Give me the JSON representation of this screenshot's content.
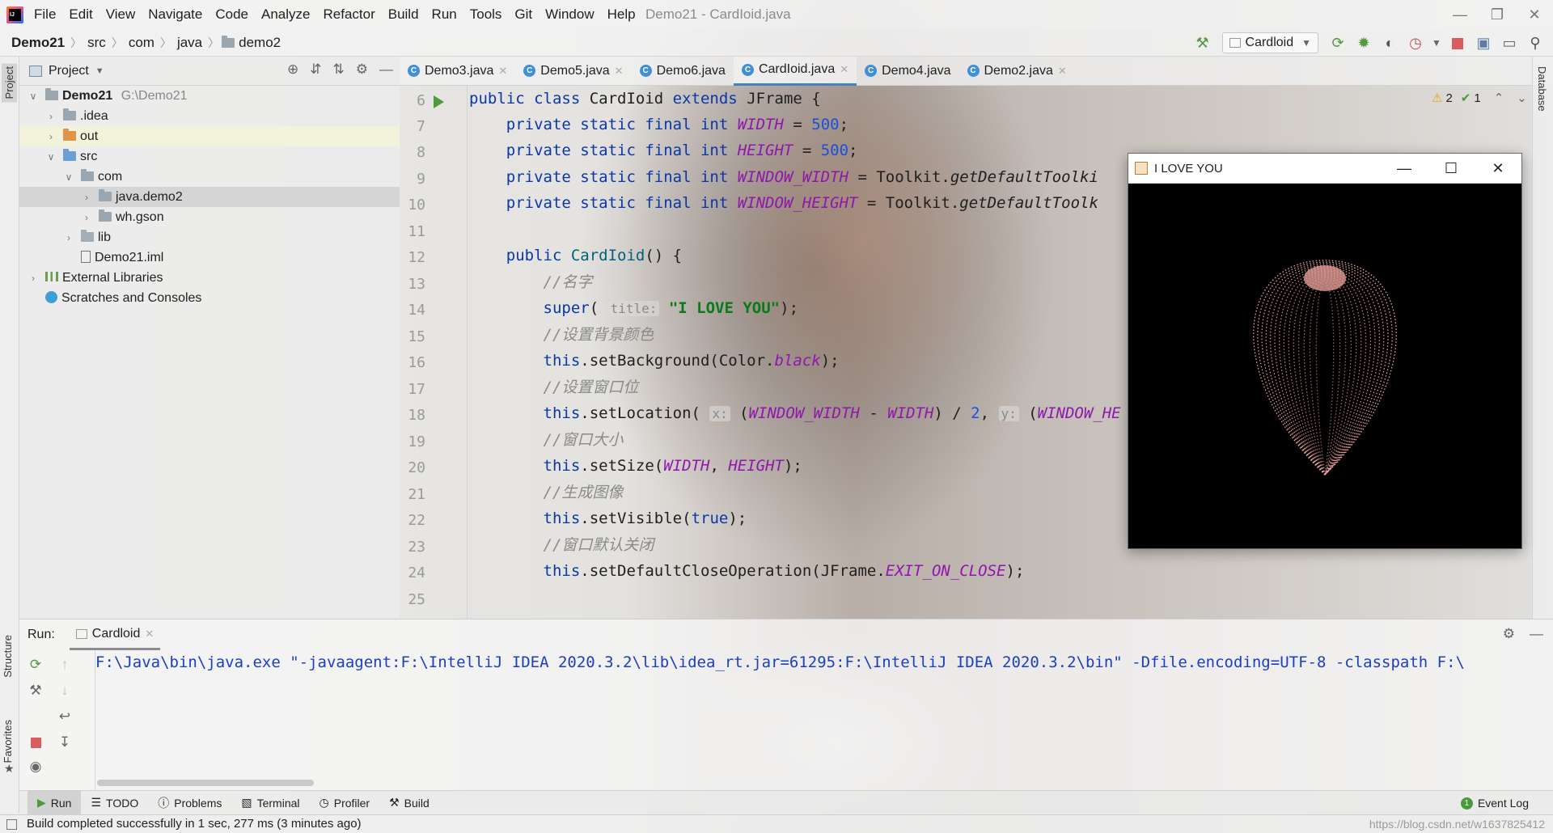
{
  "app": {
    "menu": [
      "File",
      "Edit",
      "View",
      "Navigate",
      "Code",
      "Analyze",
      "Refactor",
      "Build",
      "Run",
      "Tools",
      "Git",
      "Window",
      "Help"
    ],
    "window_title": "Demo21 - CardIoid.java"
  },
  "navbar": {
    "breadcrumbs": [
      "Demo21",
      "src",
      "com",
      "java",
      "demo2"
    ],
    "run_config": "Cardloid"
  },
  "left_stripe": {
    "project": "Project",
    "structure": "Structure",
    "favorites": "Favorites"
  },
  "right_stripe": {
    "database": "Database"
  },
  "project_panel": {
    "title": "Project",
    "tree": [
      {
        "label": "Demo21",
        "extra": "G:\\Demo21"
      },
      {
        "label": ".idea"
      },
      {
        "label": "out"
      },
      {
        "label": "src"
      },
      {
        "label": "com"
      },
      {
        "label": "java.demo2"
      },
      {
        "label": "wh.gson"
      },
      {
        "label": "lib"
      },
      {
        "label": "Demo21.iml"
      },
      {
        "label": "External Libraries"
      },
      {
        "label": "Scratches and Consoles"
      }
    ]
  },
  "editor": {
    "tabs": [
      {
        "label": "Demo3.java"
      },
      {
        "label": "Demo5.java"
      },
      {
        "label": "Demo6.java"
      },
      {
        "label": "CardIoid.java"
      },
      {
        "label": "Demo4.java"
      },
      {
        "label": "Demo2.java"
      }
    ],
    "inspections": {
      "warnings": "2",
      "weak": "1"
    },
    "line_numbers": [
      "6",
      "7",
      "8",
      "9",
      "10",
      "11",
      "12",
      "13",
      "14",
      "15",
      "16",
      "17",
      "18",
      "19",
      "20",
      "21",
      "22",
      "23",
      "24",
      "25"
    ],
    "code": {
      "l6a": "public class ",
      "l6b": "CardIoid ",
      "l6c": "extends ",
      "l6d": "JFrame {",
      "l7a": "    private static final int ",
      "l7b": "WIDTH",
      "l7c": " = ",
      "l7d": "500",
      "l7e": ";",
      "l8a": "    private static final int ",
      "l8b": "HEIGHT",
      "l8c": " = ",
      "l8d": "500",
      "l8e": ";",
      "l9a": "    private static final int ",
      "l9b": "WINDOW_WIDTH",
      "l9c": " = Toolkit.",
      "l9d": "getDefaultToolki",
      "l10a": "    private static final int ",
      "l10b": "WINDOW_HEIGHT",
      "l10c": " = Toolkit.",
      "l10d": "getDefaultToolk",
      "l12a": "    public ",
      "l12b": "CardIoid",
      "l12c": "() {",
      "l13": "        //名字",
      "l14a": "        super",
      "l14b": "( ",
      "l14c": "title:",
      "l14d": " \"I LOVE YOU\"",
      "l14e": ");",
      "l15": "        //设置背景颜色",
      "l16a": "        this",
      "l16b": ".setBackground(Color.",
      "l16c": "black",
      "l16d": ");",
      "l17": "        //设置窗口位",
      "l18a": "        this",
      "l18b": ".setLocation( ",
      "l18c": "x:",
      "l18d": " (",
      "l18e": "WINDOW_WIDTH",
      "l18f": " - ",
      "l18g": "WIDTH",
      "l18h": ") / ",
      "l18i": "2",
      "l18j": ", ",
      "l18k": "y:",
      "l18l": " (",
      "l18m": "WINDOW_HE",
      "l19": "        //窗口大小",
      "l20a": "        this",
      "l20b": ".setSize(",
      "l20c": "WIDTH",
      "l20d": ", ",
      "l20e": "HEIGHT",
      "l20f": ");",
      "l21": "        //生成图像",
      "l22a": "        this",
      "l22b": ".setVisible(",
      "l22c": "true",
      "l22d": ");",
      "l23": "        //窗口默认关闭",
      "l24a": "        this",
      "l24b": ".setDefaultCloseOperation(JFrame.",
      "l24c": "EXIT_ON_CLOSE",
      "l24d": ");"
    }
  },
  "swing_window": {
    "title": "I LOVE YOU",
    "heart_color": "#f2a6a0"
  },
  "run_panel": {
    "label": "Run:",
    "tab": "Cardloid",
    "console": "F:\\Java\\bin\\java.exe \"-javaagent:F:\\IntelliJ IDEA 2020.3.2\\lib\\idea_rt.jar=61295:F:\\IntelliJ IDEA 2020.3.2\\bin\" -Dfile.encoding=UTF-8 -classpath F:\\"
  },
  "bottom_tools": [
    "Run",
    "TODO",
    "Problems",
    "Terminal",
    "Profiler",
    "Build"
  ],
  "event_log": {
    "count": "1",
    "label": "Event Log"
  },
  "status": {
    "message": "Build completed successfully in 1 sec, 277 ms (3 minutes ago)",
    "watermark": "https://blog.csdn.net/w1637825412"
  },
  "colors": {
    "accent": "#4083c9",
    "keyword": "#0a37a8",
    "field": "#8f17ad"
  }
}
